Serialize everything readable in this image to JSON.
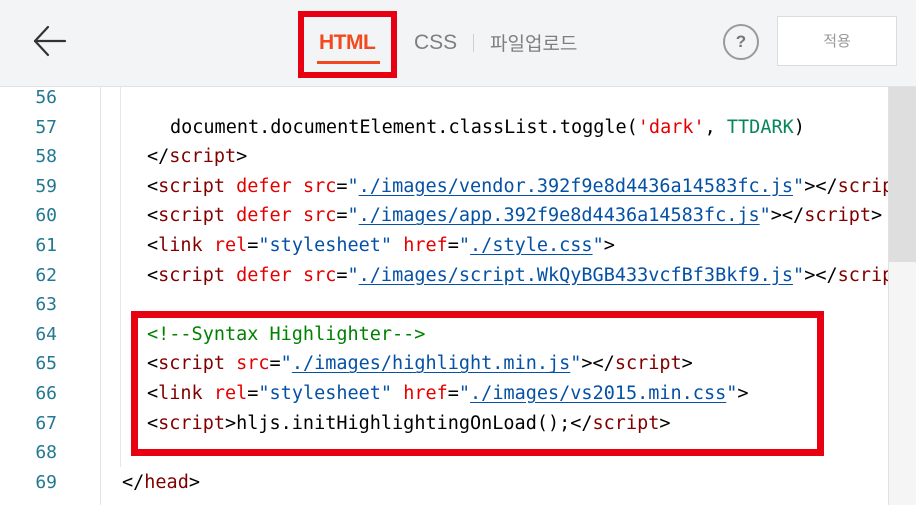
{
  "header": {
    "tabs": {
      "html": "HTML",
      "css": "CSS",
      "upload": "파일업로드"
    },
    "help_label": "?",
    "apply_label": "적용"
  },
  "colors": {
    "highlight_border": "#e60012",
    "active_tab": "#f04a1e",
    "line_number": "#237893",
    "tag": "#800000",
    "attribute": "#e50000",
    "string": "#0451a5",
    "comment": "#008000"
  },
  "icons": {
    "back": "arrow-left-icon"
  },
  "editor": {
    "lines": [
      {
        "num": "56",
        "indent": 0,
        "tokens": []
      },
      {
        "num": "57",
        "indent": 170,
        "tokens": [
          {
            "t": "plain",
            "v": "document.documentElement.classList.toggle("
          },
          {
            "t": "attr",
            "v": "'dark'"
          },
          {
            "t": "plain",
            "v": ", "
          },
          {
            "t": "const",
            "v": "TTDARK"
          },
          {
            "t": "plain",
            "v": ")"
          }
        ]
      },
      {
        "num": "58",
        "indent": 147,
        "tokens": [
          {
            "t": "plain",
            "v": "</"
          },
          {
            "t": "tag",
            "v": "script"
          },
          {
            "t": "plain",
            "v": ">"
          }
        ]
      },
      {
        "num": "59",
        "indent": 147,
        "tokens": [
          {
            "t": "plain",
            "v": "<"
          },
          {
            "t": "tag",
            "v": "script"
          },
          {
            "t": "plain",
            "v": " "
          },
          {
            "t": "attr",
            "v": "defer"
          },
          {
            "t": "plain",
            "v": " "
          },
          {
            "t": "attr",
            "v": "src"
          },
          {
            "t": "plain",
            "v": "="
          },
          {
            "t": "str",
            "v": "\""
          },
          {
            "t": "link",
            "v": "./images/vendor.392f9e8d4436a14583fc.js"
          },
          {
            "t": "str",
            "v": "\""
          },
          {
            "t": "plain",
            "v": "></"
          },
          {
            "t": "tag",
            "v": "script"
          },
          {
            "t": "plain",
            "v": ">"
          }
        ]
      },
      {
        "num": "60",
        "indent": 147,
        "tokens": [
          {
            "t": "plain",
            "v": "<"
          },
          {
            "t": "tag",
            "v": "script"
          },
          {
            "t": "plain",
            "v": " "
          },
          {
            "t": "attr",
            "v": "defer"
          },
          {
            "t": "plain",
            "v": " "
          },
          {
            "t": "attr",
            "v": "src"
          },
          {
            "t": "plain",
            "v": "="
          },
          {
            "t": "str",
            "v": "\""
          },
          {
            "t": "link",
            "v": "./images/app.392f9e8d4436a14583fc.js"
          },
          {
            "t": "str",
            "v": "\""
          },
          {
            "t": "plain",
            "v": "></"
          },
          {
            "t": "tag",
            "v": "script"
          },
          {
            "t": "plain",
            "v": ">"
          }
        ]
      },
      {
        "num": "61",
        "indent": 147,
        "tokens": [
          {
            "t": "plain",
            "v": "<"
          },
          {
            "t": "tag",
            "v": "link"
          },
          {
            "t": "plain",
            "v": " "
          },
          {
            "t": "attr",
            "v": "rel"
          },
          {
            "t": "plain",
            "v": "="
          },
          {
            "t": "str",
            "v": "\"stylesheet\""
          },
          {
            "t": "plain",
            "v": " "
          },
          {
            "t": "attr",
            "v": "href"
          },
          {
            "t": "plain",
            "v": "="
          },
          {
            "t": "str",
            "v": "\""
          },
          {
            "t": "link",
            "v": "./style.css"
          },
          {
            "t": "str",
            "v": "\""
          },
          {
            "t": "plain",
            "v": ">"
          }
        ]
      },
      {
        "num": "62",
        "indent": 147,
        "tokens": [
          {
            "t": "plain",
            "v": "<"
          },
          {
            "t": "tag",
            "v": "script"
          },
          {
            "t": "plain",
            "v": " "
          },
          {
            "t": "attr",
            "v": "defer"
          },
          {
            "t": "plain",
            "v": " "
          },
          {
            "t": "attr",
            "v": "src"
          },
          {
            "t": "plain",
            "v": "="
          },
          {
            "t": "str",
            "v": "\""
          },
          {
            "t": "link",
            "v": "./images/script.WkQyBGB433vcfBf3Bkf9.js"
          },
          {
            "t": "str",
            "v": "\""
          },
          {
            "t": "plain",
            "v": "></"
          },
          {
            "t": "tag",
            "v": "script"
          },
          {
            "t": "plain",
            "v": ">"
          }
        ]
      },
      {
        "num": "63",
        "indent": 0,
        "tokens": []
      },
      {
        "num": "64",
        "indent": 147,
        "tokens": [
          {
            "t": "comment",
            "v": "<!--Syntax Highlighter-->"
          }
        ]
      },
      {
        "num": "65",
        "indent": 147,
        "tokens": [
          {
            "t": "plain",
            "v": "<"
          },
          {
            "t": "tag",
            "v": "script"
          },
          {
            "t": "plain",
            "v": " "
          },
          {
            "t": "attr",
            "v": "src"
          },
          {
            "t": "plain",
            "v": "="
          },
          {
            "t": "str",
            "v": "\""
          },
          {
            "t": "link",
            "v": "./images/highlight.min.js"
          },
          {
            "t": "str",
            "v": "\""
          },
          {
            "t": "plain",
            "v": "></"
          },
          {
            "t": "tag",
            "v": "script"
          },
          {
            "t": "plain",
            "v": ">"
          }
        ]
      },
      {
        "num": "66",
        "indent": 147,
        "tokens": [
          {
            "t": "plain",
            "v": "<"
          },
          {
            "t": "tag",
            "v": "link"
          },
          {
            "t": "plain",
            "v": " "
          },
          {
            "t": "attr",
            "v": "rel"
          },
          {
            "t": "plain",
            "v": "="
          },
          {
            "t": "str",
            "v": "\"stylesheet\""
          },
          {
            "t": "plain",
            "v": " "
          },
          {
            "t": "attr",
            "v": "href"
          },
          {
            "t": "plain",
            "v": "="
          },
          {
            "t": "str",
            "v": "\""
          },
          {
            "t": "link",
            "v": "./images/vs2015.min.css"
          },
          {
            "t": "str",
            "v": "\""
          },
          {
            "t": "plain",
            "v": ">"
          }
        ]
      },
      {
        "num": "67",
        "indent": 147,
        "tokens": [
          {
            "t": "plain",
            "v": "<"
          },
          {
            "t": "tag",
            "v": "script"
          },
          {
            "t": "plain",
            "v": ">hljs.initHighlightingOnLoad();</"
          },
          {
            "t": "tag",
            "v": "script"
          },
          {
            "t": "plain",
            "v": ">"
          }
        ]
      },
      {
        "num": "68",
        "indent": 0,
        "tokens": []
      },
      {
        "num": "69",
        "indent": 122,
        "tokens": [
          {
            "t": "plain",
            "v": "</"
          },
          {
            "t": "tag",
            "v": "head"
          },
          {
            "t": "plain",
            "v": ">"
          }
        ]
      }
    ]
  }
}
